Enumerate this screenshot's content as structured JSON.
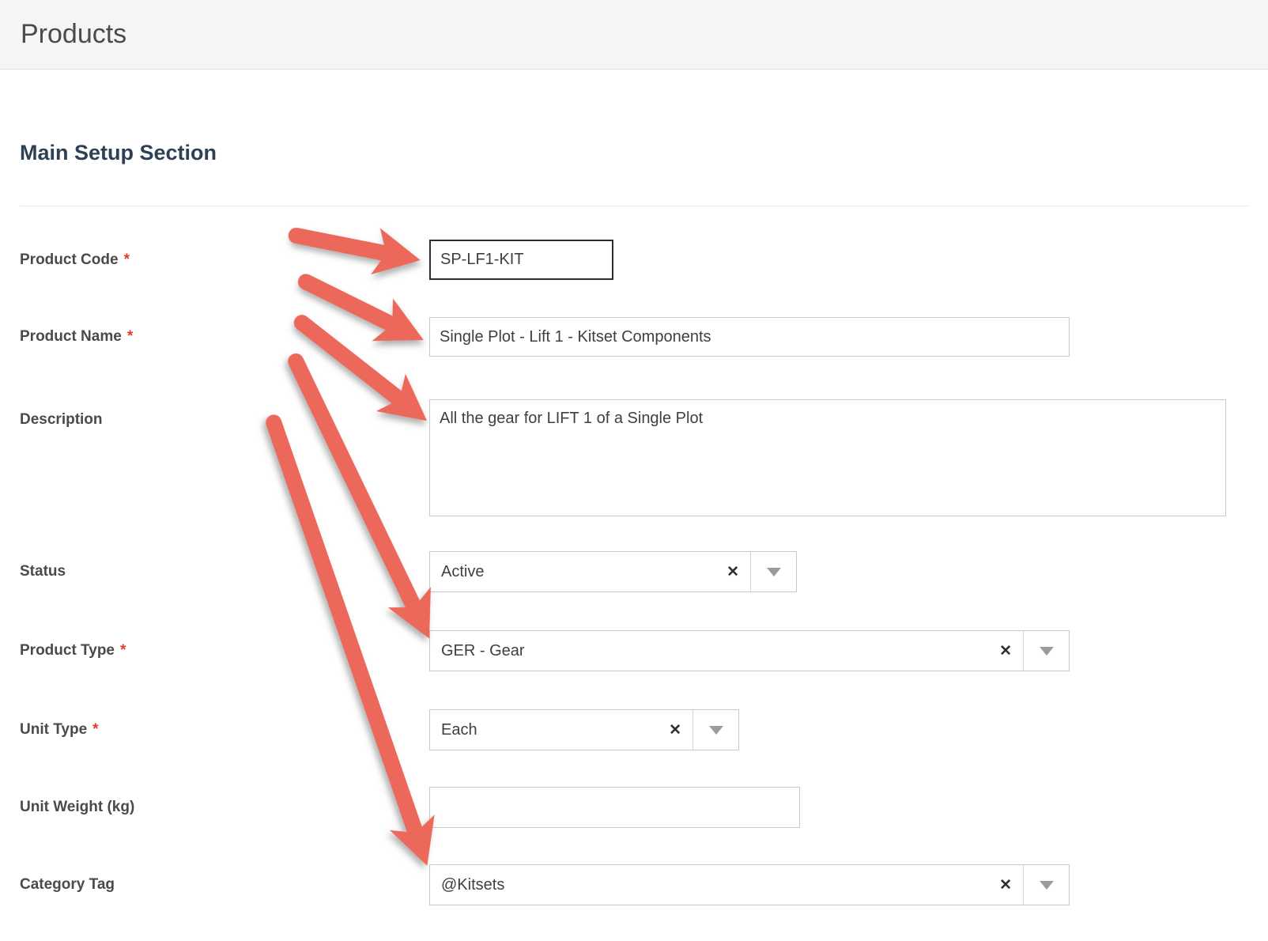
{
  "header": {
    "title": "Products"
  },
  "section": {
    "title": "Main Setup Section"
  },
  "form": {
    "required_marker": "*",
    "combo_icons": {
      "clear": "✕",
      "dropdown": "dropdown-arrow"
    },
    "fields": {
      "product_code": {
        "label": "Product Code",
        "required": true,
        "value": "SP-LF1-KIT"
      },
      "product_name": {
        "label": "Product Name",
        "required": true,
        "value": "Single Plot - Lift 1 - Kitset Components"
      },
      "description": {
        "label": "Description",
        "required": false,
        "value": "All the gear for LIFT 1 of a Single Plot"
      },
      "status": {
        "label": "Status",
        "required": false,
        "value": "Active"
      },
      "product_type": {
        "label": "Product Type",
        "required": true,
        "value": "GER - Gear"
      },
      "unit_type": {
        "label": "Unit Type",
        "required": true,
        "value": "Each"
      },
      "unit_weight": {
        "label": "Unit Weight (kg)",
        "required": false,
        "value": ""
      },
      "category_tag": {
        "label": "Category Tag",
        "required": false,
        "value": "@Kitsets"
      }
    }
  },
  "annotations": {
    "arrow_color": "#ec685a",
    "arrows": [
      {
        "target": "product-code"
      },
      {
        "target": "product-name"
      },
      {
        "target": "description"
      },
      {
        "target": "product-type"
      },
      {
        "target": "category-tag"
      }
    ]
  }
}
